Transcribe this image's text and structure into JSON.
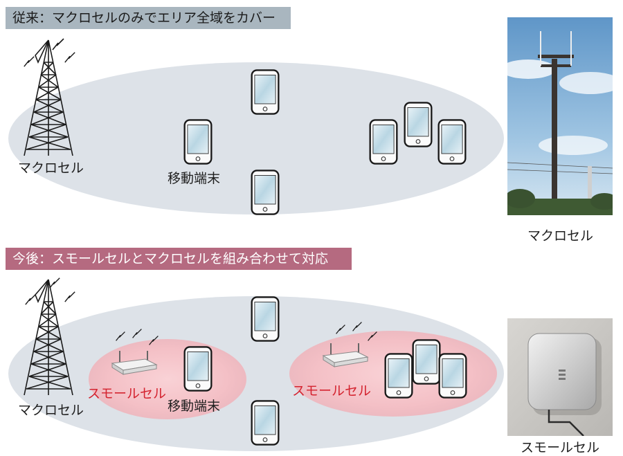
{
  "top_section": {
    "title": "従来：マクロセルのみでエリア全域をカバー",
    "macro_cell_label": "マクロセル",
    "terminal_label": "移動端末",
    "photo_caption": "マクロセル"
  },
  "bottom_section": {
    "title": "今後：スモールセルとマクロセルを組み合わせて対応",
    "macro_cell_label": "マクロセル",
    "small_cell_label_left": "スモールセル",
    "small_cell_label_right": "スモールセル",
    "terminal_label": "移動端末",
    "photo_caption": "スモールセル"
  },
  "colors": {
    "top_header_bg": "#a9b6bf",
    "bottom_header_bg": "#b56a80",
    "macro_area": "#dde2e8",
    "small_area": "#f6c6cc",
    "small_label": "#d4232f"
  }
}
